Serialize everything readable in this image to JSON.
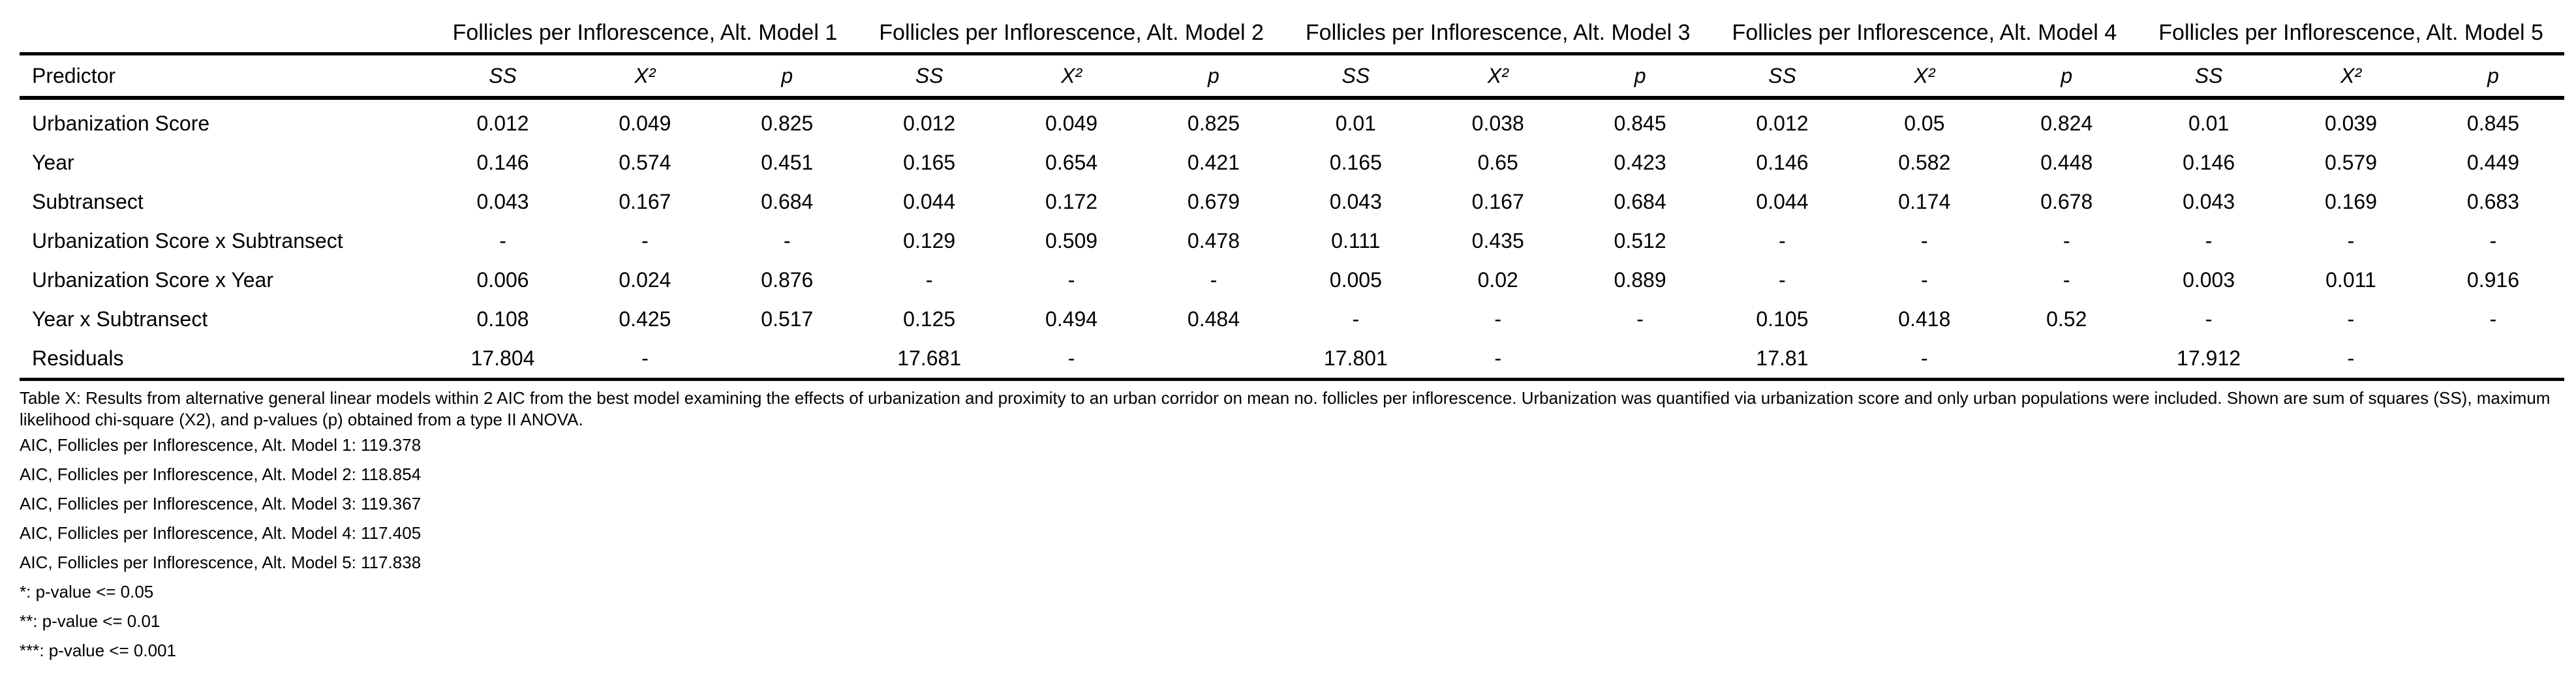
{
  "table": {
    "groups": [
      "Follicles per Inflorescence, Alt. Model 1",
      "Follicles per Inflorescence, Alt. Model 2",
      "Follicles per Inflorescence, Alt. Model 3",
      "Follicles per Inflorescence, Alt. Model 4",
      "Follicles per Inflorescence, Alt. Model 5"
    ],
    "predictor_header": "Predictor",
    "subheaders": [
      "SS",
      "X²",
      "p"
    ],
    "rows": [
      {
        "label": "Urbanization Score",
        "cells": [
          "0.012",
          "0.049",
          "0.825",
          "0.012",
          "0.049",
          "0.825",
          "0.01",
          "0.038",
          "0.845",
          "0.012",
          "0.05",
          "0.824",
          "0.01",
          "0.039",
          "0.845"
        ]
      },
      {
        "label": "Year",
        "cells": [
          "0.146",
          "0.574",
          "0.451",
          "0.165",
          "0.654",
          "0.421",
          "0.165",
          "0.65",
          "0.423",
          "0.146",
          "0.582",
          "0.448",
          "0.146",
          "0.579",
          "0.449"
        ]
      },
      {
        "label": "Subtransect",
        "cells": [
          "0.043",
          "0.167",
          "0.684",
          "0.044",
          "0.172",
          "0.679",
          "0.043",
          "0.167",
          "0.684",
          "0.044",
          "0.174",
          "0.678",
          "0.043",
          "0.169",
          "0.683"
        ]
      },
      {
        "label": "Urbanization Score x Subtransect",
        "cells": [
          "-",
          "-",
          "-",
          "0.129",
          "0.509",
          "0.478",
          "0.111",
          "0.435",
          "0.512",
          "-",
          "-",
          "-",
          "-",
          "-",
          "-"
        ]
      },
      {
        "label": "Urbanization Score x Year",
        "cells": [
          "0.006",
          "0.024",
          "0.876",
          "-",
          "-",
          "-",
          "0.005",
          "0.02",
          "0.889",
          "-",
          "-",
          "-",
          "0.003",
          "0.011",
          "0.916"
        ]
      },
      {
        "label": "Year x Subtransect",
        "cells": [
          "0.108",
          "0.425",
          "0.517",
          "0.125",
          "0.494",
          "0.484",
          "-",
          "-",
          "-",
          "0.105",
          "0.418",
          "0.52",
          "-",
          "-",
          "-"
        ]
      },
      {
        "label": "Residuals",
        "cells": [
          "17.804",
          "-",
          "",
          "17.681",
          "-",
          "",
          "17.801",
          "-",
          "",
          "17.81",
          "-",
          "",
          "17.912",
          "-",
          ""
        ]
      }
    ]
  },
  "caption": "Table X: Results from alternative general linear models within 2 AIC from the best model examining the effects of urbanization and proximity to an urban corridor on mean no. follicles per inflorescence. Urbanization was quantified via urbanization score and only urban populations were included. Shown are sum of squares (SS), maximum likelihood chi-square (X2), and p-values (p) obtained from a type II ANOVA.",
  "notes": [
    "AIC, Follicles per Inflorescence, Alt. Model 1: 119.378",
    "AIC, Follicles per Inflorescence, Alt. Model 2: 118.854",
    "AIC, Follicles per Inflorescence, Alt. Model 3: 119.367",
    "AIC, Follicles per Inflorescence, Alt. Model 4: 117.405",
    "AIC, Follicles per Inflorescence, Alt. Model 5: 117.838",
    "*: p-value <= 0.05",
    "**: p-value <= 0.01",
    "***: p-value <= 0.001"
  ]
}
